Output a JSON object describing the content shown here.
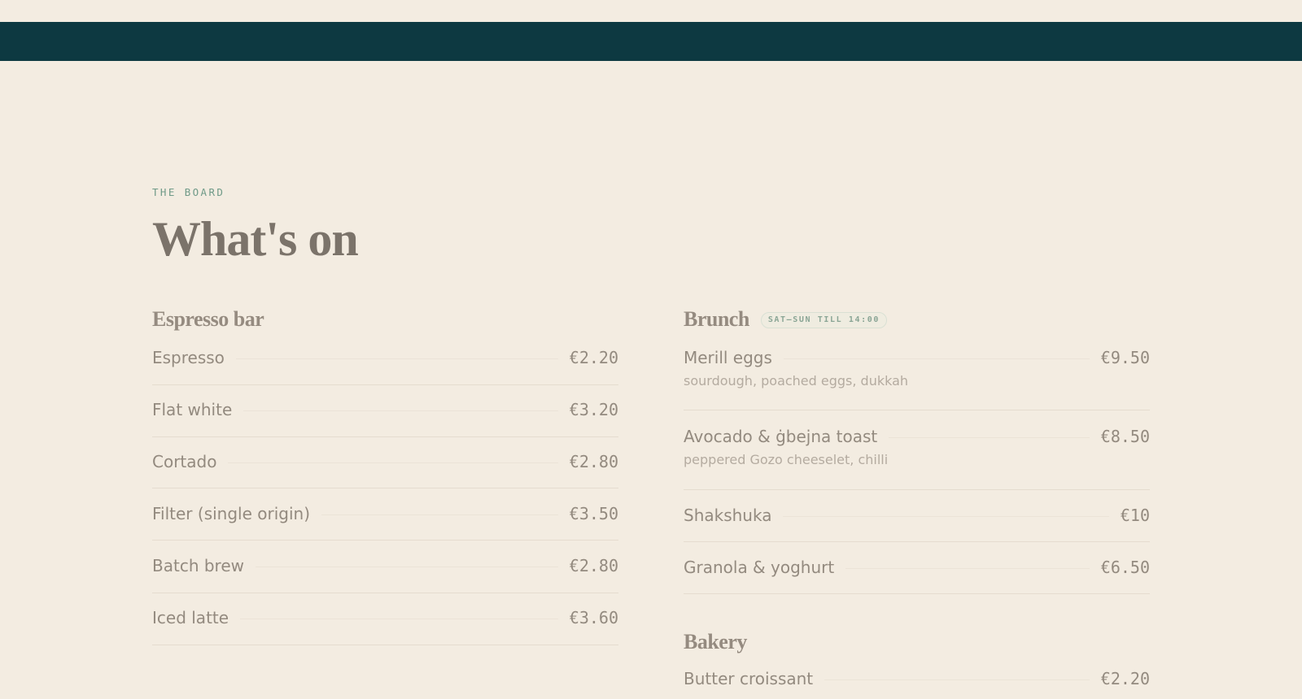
{
  "board": {
    "eyebrow": "THE BOARD",
    "title": "What's on"
  },
  "espresso_bar": {
    "title": "Espresso bar",
    "items": [
      {
        "name": "Espresso",
        "price": "€2.20"
      },
      {
        "name": "Flat white",
        "price": "€3.20"
      },
      {
        "name": "Cortado",
        "price": "€2.80"
      },
      {
        "name": "Filter (single origin)",
        "price": "€3.50"
      },
      {
        "name": "Batch brew",
        "price": "€2.80"
      },
      {
        "name": "Iced latte",
        "price": "€3.60"
      }
    ]
  },
  "brunch": {
    "title": "Brunch",
    "badge": "SAT–SUN TILL 14:00",
    "items": [
      {
        "name": "Merill eggs",
        "price": "€9.50",
        "desc": "sourdough, poached eggs, dukkah"
      },
      {
        "name": "Avocado & ġbejna toast",
        "price": "€8.50",
        "desc": "peppered Gozo cheeselet, chilli"
      },
      {
        "name": "Shakshuka",
        "price": "€10"
      },
      {
        "name": "Granola & yoghurt",
        "price": "€6.50"
      }
    ]
  },
  "bakery": {
    "title": "Bakery",
    "items": [
      {
        "name": "Butter croissant",
        "price": "€2.20"
      }
    ]
  },
  "colors": {
    "header_bar": "#0d3941",
    "background": "#f3ece1",
    "accent": "#6f9a88"
  }
}
